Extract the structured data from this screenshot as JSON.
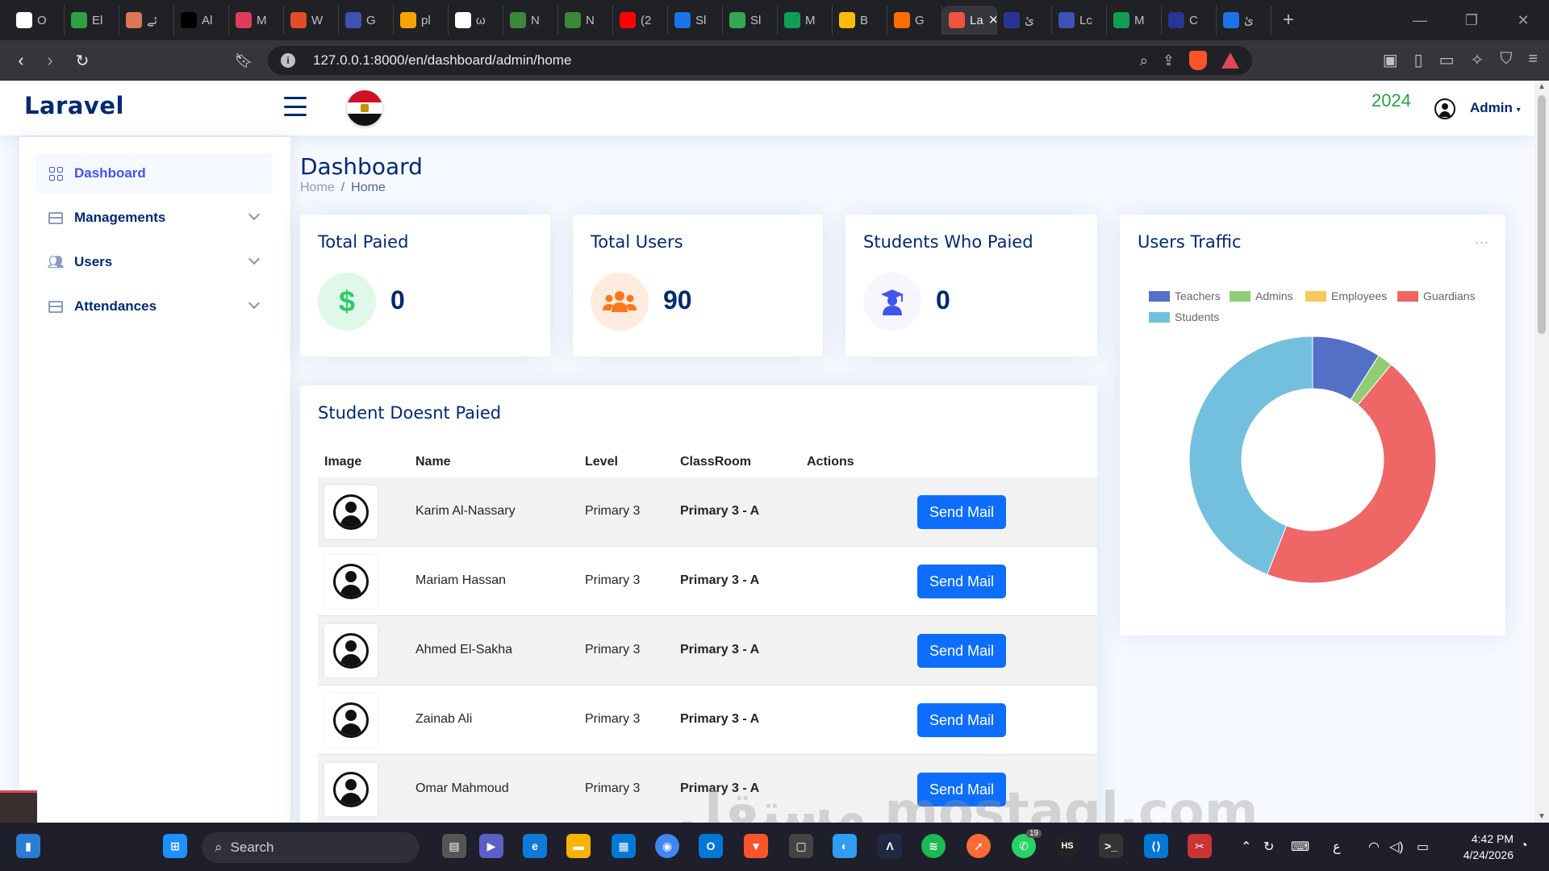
{
  "browser": {
    "tabs": [
      {
        "label": "O",
        "icon": "github-icon",
        "color": "#ffffff"
      },
      {
        "label": "El",
        "icon": "terminal-icon",
        "color": "#2ea043"
      },
      {
        "label": "ئے",
        "icon": "claude-icon",
        "color": "#d97757"
      },
      {
        "label": "Al",
        "icon": "app-icon",
        "color": "#000000"
      },
      {
        "label": "M",
        "icon": "m-logo-icon",
        "color": "#e03c5a"
      },
      {
        "label": "W",
        "icon": "w-icon",
        "color": "#e34c26"
      },
      {
        "label": "G",
        "icon": "g-icon",
        "color": "#3f51b5"
      },
      {
        "label": "pl",
        "icon": "pl-icon",
        "color": "#f4a300"
      },
      {
        "label": "ω",
        "icon": "openai-icon",
        "color": "#ffffff"
      },
      {
        "label": "N",
        "icon": "node-icon",
        "color": "#3c873a"
      },
      {
        "label": "N",
        "icon": "node-icon",
        "color": "#3c873a"
      },
      {
        "label": "(2",
        "icon": "youtube-icon",
        "color": "#ff0000"
      },
      {
        "label": "Sl",
        "icon": "profile-icon",
        "color": "#1a73e8"
      },
      {
        "label": "Sl",
        "icon": "drive-icon",
        "color": "#34a853"
      },
      {
        "label": "M",
        "icon": "sheets-icon",
        "color": "#0f9d58"
      },
      {
        "label": "B",
        "icon": "drive-icon",
        "color": "#fbbc04"
      },
      {
        "label": "G",
        "icon": "fire-icon",
        "color": "#ff6d00"
      },
      {
        "label": "La",
        "icon": "laravel-icon",
        "color": "#f05340",
        "active": true
      },
      {
        "label": "ئ",
        "icon": "doc-icon",
        "color": "#283593"
      },
      {
        "label": "Lc",
        "icon": "m-wave-icon",
        "color": "#3f51b5"
      },
      {
        "label": "M",
        "icon": "sheets-icon",
        "color": "#0f9d58"
      },
      {
        "label": "C",
        "icon": "doc-icon",
        "color": "#283593"
      },
      {
        "label": "ئ",
        "icon": "circle-icon",
        "color": "#1a73e8"
      }
    ],
    "url": "127.0.0.1:8000/en/dashboard/admin/home"
  },
  "header": {
    "logo": "Laravel",
    "year": "2024",
    "user": "Admin"
  },
  "sidebar": {
    "items": [
      {
        "label": "Dashboard",
        "icon": "grid-icon",
        "active": true
      },
      {
        "label": "Managements",
        "icon": "menu-icon",
        "expandable": true
      },
      {
        "label": "Users",
        "icon": "people-icon",
        "expandable": true
      },
      {
        "label": "Attendances",
        "icon": "menu-icon",
        "expandable": true
      }
    ]
  },
  "page": {
    "title": "Dashboard",
    "breadcrumb": [
      "Home",
      "Home"
    ]
  },
  "cards": {
    "total_paid": {
      "title": "Total Paied",
      "value": "0",
      "icon": "dollar-icon",
      "color": "#2eca6a"
    },
    "total_users": {
      "title": "Total Users",
      "value": "90",
      "icon": "users-icon",
      "color": "#ff771d"
    },
    "students_paid": {
      "title": "Students Who Paied",
      "value": "0",
      "icon": "graduate-icon",
      "color": "#4154f1"
    }
  },
  "table": {
    "title": "Student Doesnt Paied",
    "headers": [
      "Image",
      "Name",
      "Level",
      "ClassRoom",
      "Actions"
    ],
    "rows": [
      {
        "name": "Karim Al-Nassary",
        "level": "Primary 3",
        "classroom": "Primary 3 - A",
        "action": "Send Mail"
      },
      {
        "name": "Mariam Hassan",
        "level": "Primary 3",
        "classroom": "Primary 3 - A",
        "action": "Send Mail"
      },
      {
        "name": "Ahmed El-Sakha",
        "level": "Primary 3",
        "classroom": "Primary 3 - A",
        "action": "Send Mail"
      },
      {
        "name": "Zainab Ali",
        "level": "Primary 3",
        "classroom": "Primary 3 - A",
        "action": "Send Mail"
      },
      {
        "name": "Omar Mahmoud",
        "level": "Primary 3",
        "classroom": "Primary 3 - A",
        "action": "Send Mail"
      }
    ]
  },
  "traffic": {
    "title": "Users Traffic",
    "more": "..."
  },
  "chart_data": {
    "type": "pie",
    "variant": "doughnut",
    "title": "Users Traffic",
    "legend_position": "top",
    "series": [
      {
        "name": "Teachers",
        "value": 9,
        "color": "#5470c6"
      },
      {
        "name": "Admins",
        "value": 2,
        "color": "#91cc75"
      },
      {
        "name": "Employees",
        "value": 0,
        "color": "#fac858"
      },
      {
        "name": "Guardians",
        "value": 45,
        "color": "#ee6666"
      },
      {
        "name": "Students",
        "value": 44,
        "color": "#73c0de"
      }
    ]
  },
  "watermark": "مستقل mostaql.com",
  "taskbar": {
    "search": "Search",
    "time": "4:42 PM",
    "date": "4/24/2026",
    "lang": "ع",
    "badge": "19"
  }
}
